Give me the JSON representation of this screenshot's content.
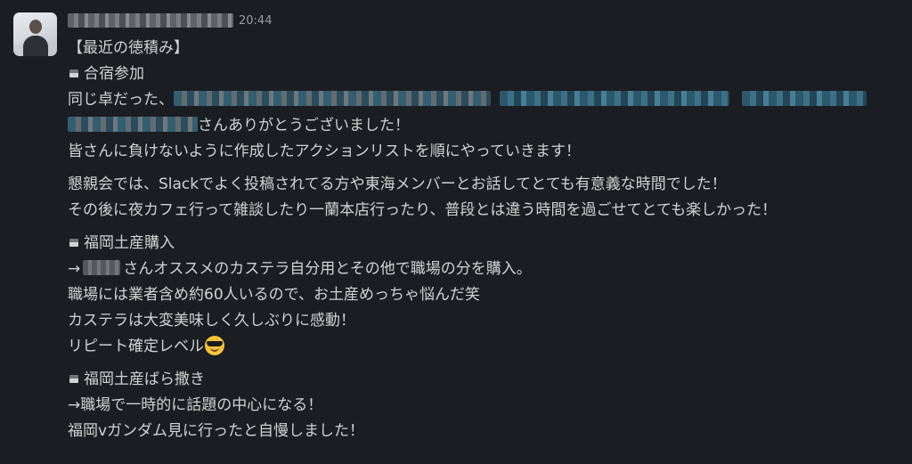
{
  "message": {
    "timestamp": "20:44",
    "lines": {
      "l1": "【最近の徳積み】",
      "l2": "合宿参加",
      "l3": "同じ卓だった、",
      "l4": "さんありがとうございました！",
      "l5": "皆さんに負けないように作成したアクションリストを順にやっていきます！",
      "l6": "懇親会では、Slackでよく投稿されてる方や東海メンバーとお話してとても有意義な時間でした！",
      "l7": "その後に夜カフェ行って雑談したり一蘭本店行ったり、普段とは違う時間を過ごせてとても楽しかった！",
      "l8": "福岡土産購入",
      "l9a": "→",
      "l9b": "さんオススメのカステラ自分用とその他で職場の分を購入。",
      "l10": "職場には業者含め約60人いるので、お土産めっちゃ悩んだ笑",
      "l11": "カステラは大変美味しく久しぶりに感動！",
      "l12": "リピート確定レベル",
      "l13": "福岡土産ばら撒き",
      "l14": "→職場で一時的に話題の中心になる！",
      "l15": "福岡vガンダム見に行ったと自慢しました！"
    },
    "icons": {
      "bullet": "black-medium-square-icon",
      "emoji": "smiling-face-with-sunglasses-icon"
    }
  }
}
